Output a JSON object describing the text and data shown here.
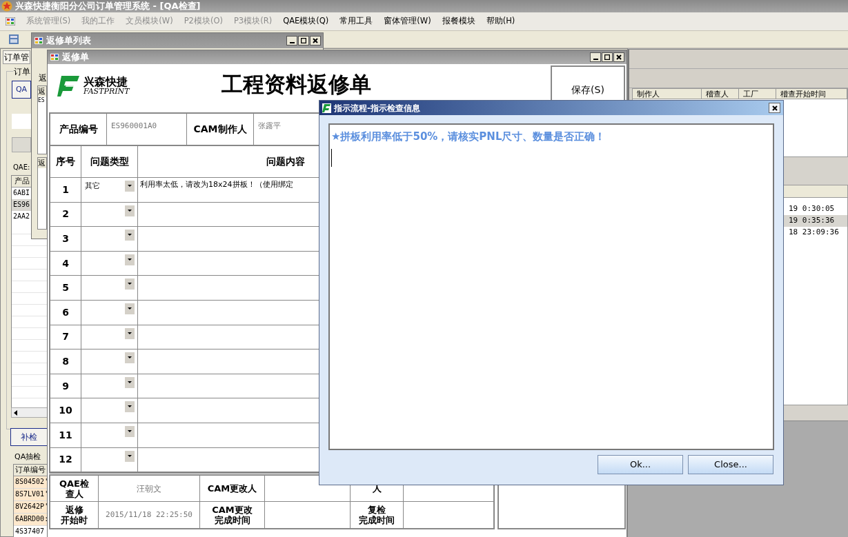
{
  "app_title": "兴森快捷衡阳分公司订单管理系统 - [QA检查]",
  "menu": [
    {
      "label": "系统管理(S)",
      "disabled": true
    },
    {
      "label": "我的工作",
      "disabled": true
    },
    {
      "label": "文员模块(W)",
      "disabled": true
    },
    {
      "label": "P2模块(O)",
      "disabled": true
    },
    {
      "label": "P3模块(R)",
      "disabled": true
    },
    {
      "label": "QAE模块(Q)",
      "disabled": false
    },
    {
      "label": "常用工具",
      "disabled": false
    },
    {
      "label": "窗体管理(W)",
      "disabled": false
    },
    {
      "label": "报餐模块",
      "disabled": false
    },
    {
      "label": "帮助(H)",
      "disabled": false
    }
  ],
  "qa_window": {
    "tab": "订单管",
    "group": "订单",
    "qa_button": "QA",
    "qae_group": "QAE:",
    "qae_header": "产品",
    "qae_rows": [
      {
        "text": "6ABI",
        "selected": false
      },
      {
        "text": "ES96",
        "selected": true
      },
      {
        "text": "2AA2",
        "selected": false
      }
    ],
    "recheck_button": "补检",
    "sample_group": "QA抽检",
    "sample_header": "订单编号",
    "sample_rows": [
      {
        "text": "8S04502'",
        "highlighted": true
      },
      {
        "text": "8S7LV01'",
        "highlighted": true
      },
      {
        "text": "8V2642P'",
        "highlighted": true
      },
      {
        "text": "6ABRD00:",
        "highlighted": true
      },
      {
        "text": "4S37407",
        "highlighted": false
      }
    ]
  },
  "list_window": {
    "title": "返修单列表",
    "group": "返",
    "header": "返",
    "row": "ES",
    "header_2": "返"
  },
  "form_window": {
    "title": "返修单",
    "brand_cn": "兴森快捷",
    "brand_en": "FASTPRINT",
    "heading": "工程资料返修单",
    "save_button": "保存(S)",
    "fields": [
      {
        "label": "产品编号",
        "value": "ES960001A0"
      },
      {
        "label": "CAM制作人",
        "value": "张露平"
      }
    ],
    "columns": [
      "序号",
      "问题类型",
      "问题内容"
    ],
    "rows": [
      {
        "no": "1",
        "type": "其它",
        "content": "利用率太低，请改为18x24拼板！（使用绑定"
      },
      {
        "no": "2"
      },
      {
        "no": "3"
      },
      {
        "no": "4"
      },
      {
        "no": "5"
      },
      {
        "no": "6"
      },
      {
        "no": "7"
      },
      {
        "no": "8"
      },
      {
        "no": "9"
      },
      {
        "no": "10"
      },
      {
        "no": "11"
      },
      {
        "no": "12"
      }
    ],
    "footer": [
      [
        {
          "label_lines": [
            "QAE检",
            "查人"
          ],
          "value": "汪朝文"
        },
        {
          "label_lines": [
            "CAM更改人"
          ]
        },
        {
          "label_lines": [
            "人"
          ]
        }
      ],
      [
        {
          "label_lines": [
            "返修",
            "开始时"
          ],
          "value": "2015/11/18 22:25:50"
        },
        {
          "label_lines": [
            "CAM更改",
            "完成时间"
          ]
        },
        {
          "label_lines": [
            "复检",
            "完成时间"
          ]
        }
      ]
    ]
  },
  "right_panel": {
    "columns": [
      "制作人",
      "稽查人",
      "工厂",
      "稽查开始时间"
    ],
    "rows": [
      {
        "text": "19 0:30:05",
        "selected": false
      },
      {
        "text": "19 0:35:36",
        "selected": true
      },
      {
        "text": "18 23:09:36",
        "selected": false
      }
    ]
  },
  "dialog": {
    "title": "指示流程-指示检查信息",
    "message": "★拼板利用率低于50%，请核实PNL尺寸、数量是否正确！",
    "buttons": [
      "Ok...",
      "Close..."
    ]
  }
}
